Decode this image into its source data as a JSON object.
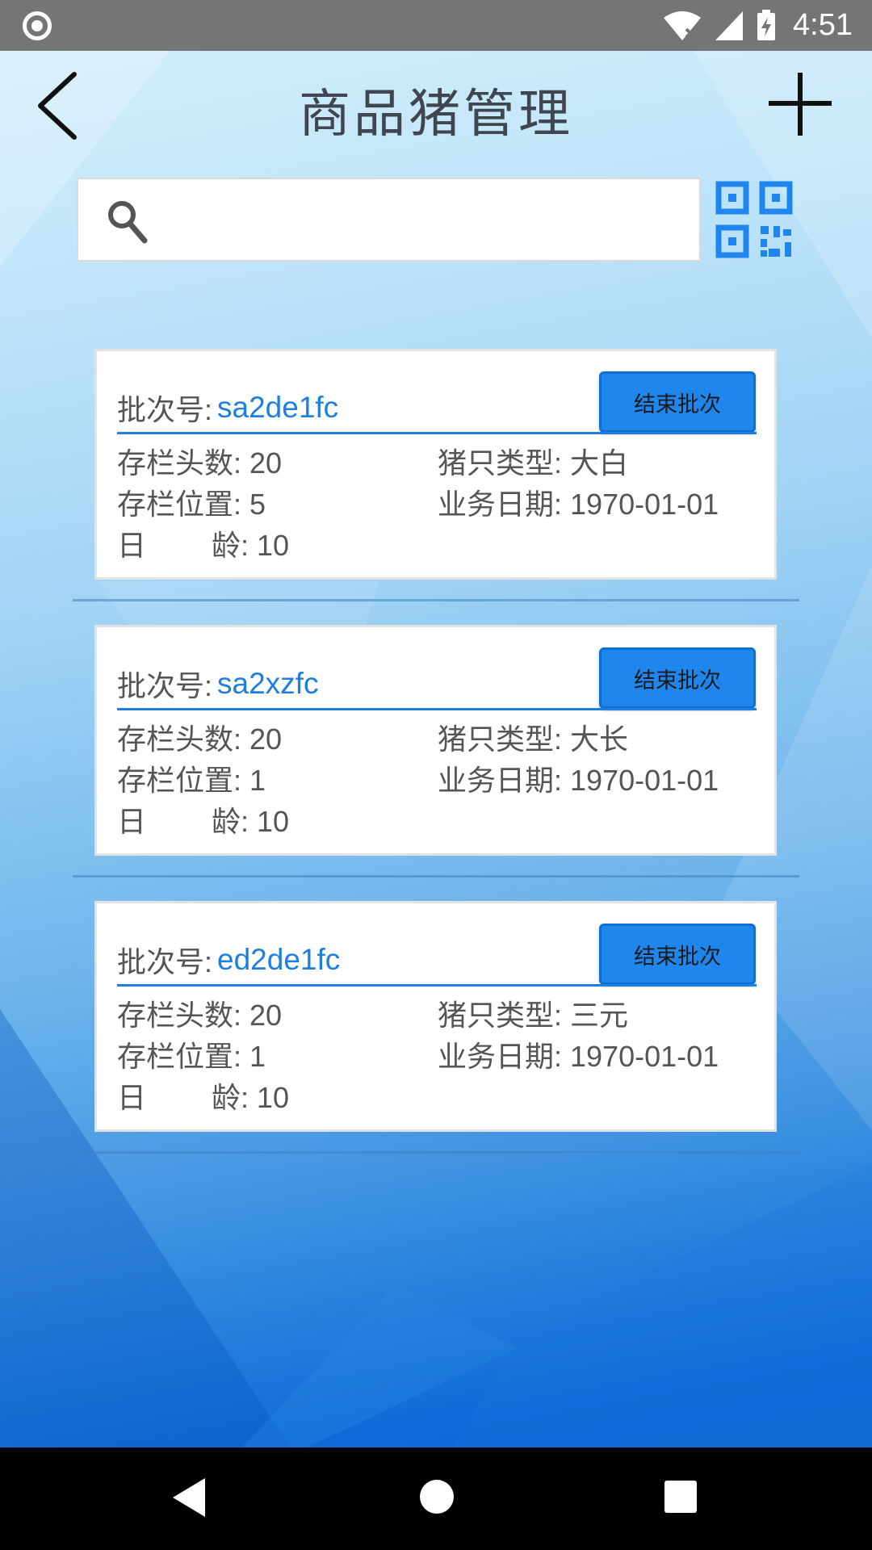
{
  "status_bar": {
    "time": "4:51"
  },
  "header": {
    "title": "商品猪管理"
  },
  "search": {
    "placeholder": "",
    "value": ""
  },
  "cards": [
    {
      "batch_label": "批次号:",
      "batch_no": "sa2de1fc",
      "end_button": "结束批次",
      "stock_count": "存栏头数: 20",
      "pig_type": "猪只类型: 大白",
      "stock_position": "存栏位置: 5",
      "business_date": "业务日期: 1970-01-01",
      "age_char1": "日",
      "age_rest": "龄: 10"
    },
    {
      "batch_label": "批次号:",
      "batch_no": "sa2xzfc",
      "end_button": "结束批次",
      "stock_count": "存栏头数: 20",
      "pig_type": "猪只类型: 大长",
      "stock_position": "存栏位置: 1",
      "business_date": "业务日期: 1970-01-01",
      "age_char1": "日",
      "age_rest": "龄: 10"
    },
    {
      "batch_label": "批次号:",
      "batch_no": "ed2de1fc",
      "end_button": "结束批次",
      "stock_count": "存栏头数: 20",
      "pig_type": "猪只类型: 三元",
      "stock_position": "存栏位置: 1",
      "business_date": "业务日期: 1970-01-01",
      "age_char1": "日",
      "age_rest": "龄: 10"
    }
  ],
  "icons": {
    "back": "back-arrow-icon",
    "add": "plus-icon",
    "search": "search-icon",
    "qr": "qr-code-icon"
  },
  "colors": {
    "accent": "#1e86ec",
    "link": "#1e7fe0",
    "title": "#3f4650"
  }
}
